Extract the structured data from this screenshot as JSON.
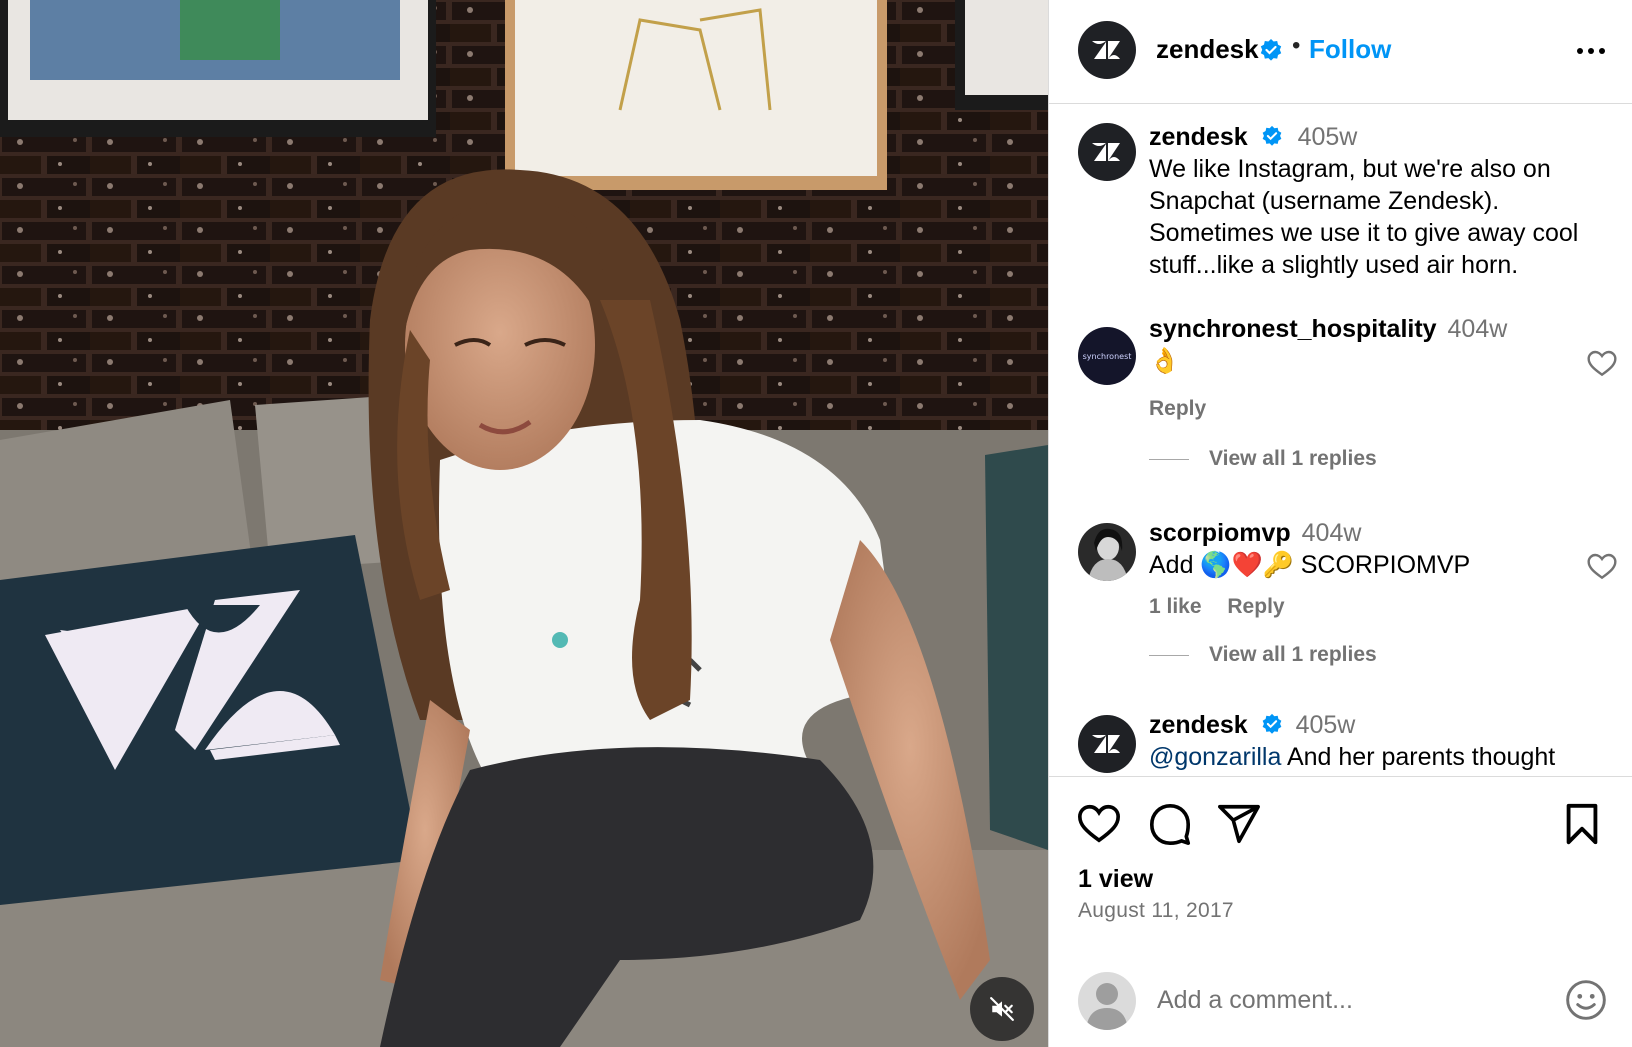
{
  "post": {
    "author": "zendesk",
    "follow_label": "Follow",
    "dot": "•",
    "caption": {
      "author": "zendesk",
      "time": "405w",
      "text": "We like Instagram, but we're also on Snapchat (username Zendesk). Sometimes we use it to give away cool stuff...like a slightly used air horn."
    },
    "views": "1 view",
    "date": "August 11, 2017"
  },
  "comments": [
    {
      "user": "synchronest_hospitality",
      "avatar_text": "synchronest",
      "time": "404w",
      "text": "👌",
      "reply_label": "Reply",
      "view_replies": "View all 1 replies"
    },
    {
      "user": "scorpiomvp",
      "time": "404w",
      "text": "Add 🌎❤️🔑 SCORPIOMVP",
      "likes": "1 like",
      "reply_label": "Reply",
      "view_replies": "View all 1 replies"
    },
    {
      "user": "zendesk",
      "time": "405w",
      "mention": "@gonzarilla",
      "text": " And her parents thought"
    }
  ],
  "add_comment": {
    "placeholder": "Add a comment..."
  },
  "colors": {
    "accent": "#0095f6",
    "secondary_text": "#737373",
    "verified": "#0095f6"
  },
  "icons": [
    "mute-icon",
    "verified-badge-icon",
    "more-icon",
    "heart-icon",
    "comment-icon",
    "share-icon",
    "bookmark-icon",
    "emoji-icon",
    "zendesk-logo-icon"
  ]
}
